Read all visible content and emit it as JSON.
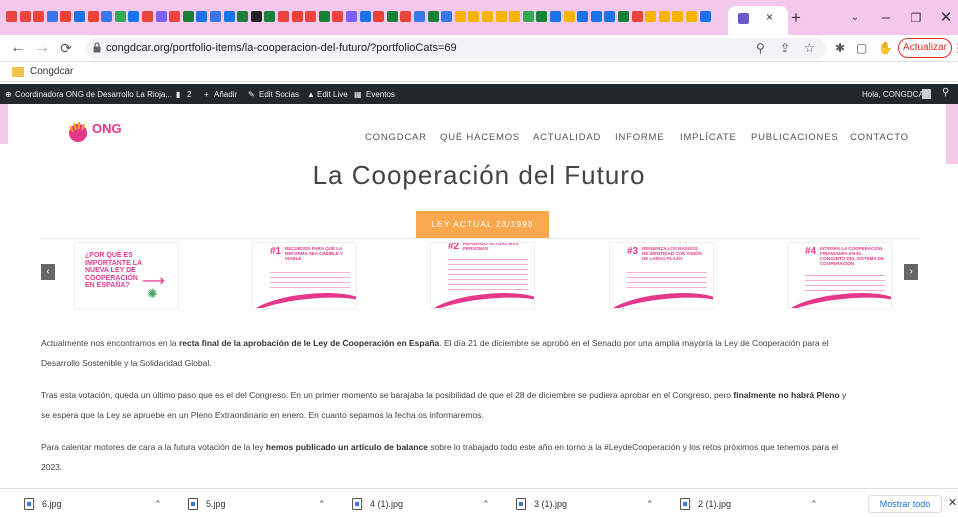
{
  "browser": {
    "url": "congdcar.org/portfolio-items/la-cooperacion-del-futuro/?portfolioCats=69",
    "update_label": "Actualizar",
    "tab_new_icon": "+",
    "tab_close_icon": "×",
    "bookmark_folder": "Congdcar"
  },
  "adminbar": {
    "site": "Coordinadora ONG de Desarrollo La Rioja...",
    "comments_count": "2",
    "add": "Añadir",
    "edit_social": "Edit Socias",
    "edit_live": "Edit Live",
    "events": "Eventos",
    "greeting": "Hola, CONGDCAR"
  },
  "site": {
    "logo_text": "ONG",
    "nav": [
      "CONGDCAR",
      "QUÉ HACEMOS",
      "ACTUALIDAD",
      "INFORME",
      "IMPLÍCATE",
      "PUBLICACIONES",
      "CONTACTO"
    ],
    "title": "La Cooperación del Futuro",
    "tab_label": "LEY ACTUAL 23/1998"
  },
  "slides": [
    {
      "question": "¿POR QUÉ ES IMPORTANTE LA NUEVA LEY DE COOPERACIÓN EN ESPAÑA?"
    },
    {
      "num": "#1",
      "heading": "Recursos para que la reforma sea creíble y viable"
    },
    {
      "num": "#2",
      "heading": "Refuerzo actual más personas"
    },
    {
      "num": "#3",
      "heading": "Refuerza los rasgos de identidad con visión de largo plazo"
    },
    {
      "num": "#4",
      "heading": "Integra la cooperación financiera en el conjunto del sistema de cooperación"
    }
  ],
  "content": {
    "p1_a": "Actualmente nos encontramos en la ",
    "p1_b": "recta final de la aprobación de le Ley de Cooperación en España",
    "p1_c": ". El día 21 de diciembre se aprobó en el Senado por una amplia mayoría la Ley de Cooperación para el",
    "p1_d": "Desarrollo Sostenible y la Solidaridad Global.",
    "p2_a": "Tras esta votación, queda un último paso que es el del Congreso. En un primer momento se barajaba la posibilidad de que el 28 de diciembre se pudiera aprobar en el Congreso, pero ",
    "p2_b": "finalmente no habrá Pleno",
    "p2_c": " y",
    "p2_d": "se espera que la Ley se apruebe en un Pleno Extraordinario en enero. En cuanto sepamos la fecha os informaremos.",
    "p3_a": "Para calentar motores de cara a la futura votación de la ley ",
    "p3_b": "hemos publicado un artículo de balance",
    "p3_c": " sobre lo trabajado todo este año en torno a la #LeydeCooperación y los retos próximos que tenemos para el",
    "p3_d": "2023."
  },
  "downloads": {
    "files": [
      "6.jpg",
      "5.jpg",
      "4 (1).jpg",
      "3 (1).jpg",
      "2 (1).jpg"
    ],
    "show_all": "Mostrar todo"
  },
  "colors": {
    "accent_pink": "#e6388b",
    "tab_orange": "#f9a84d",
    "tabstrip": "#f4c8ec"
  }
}
